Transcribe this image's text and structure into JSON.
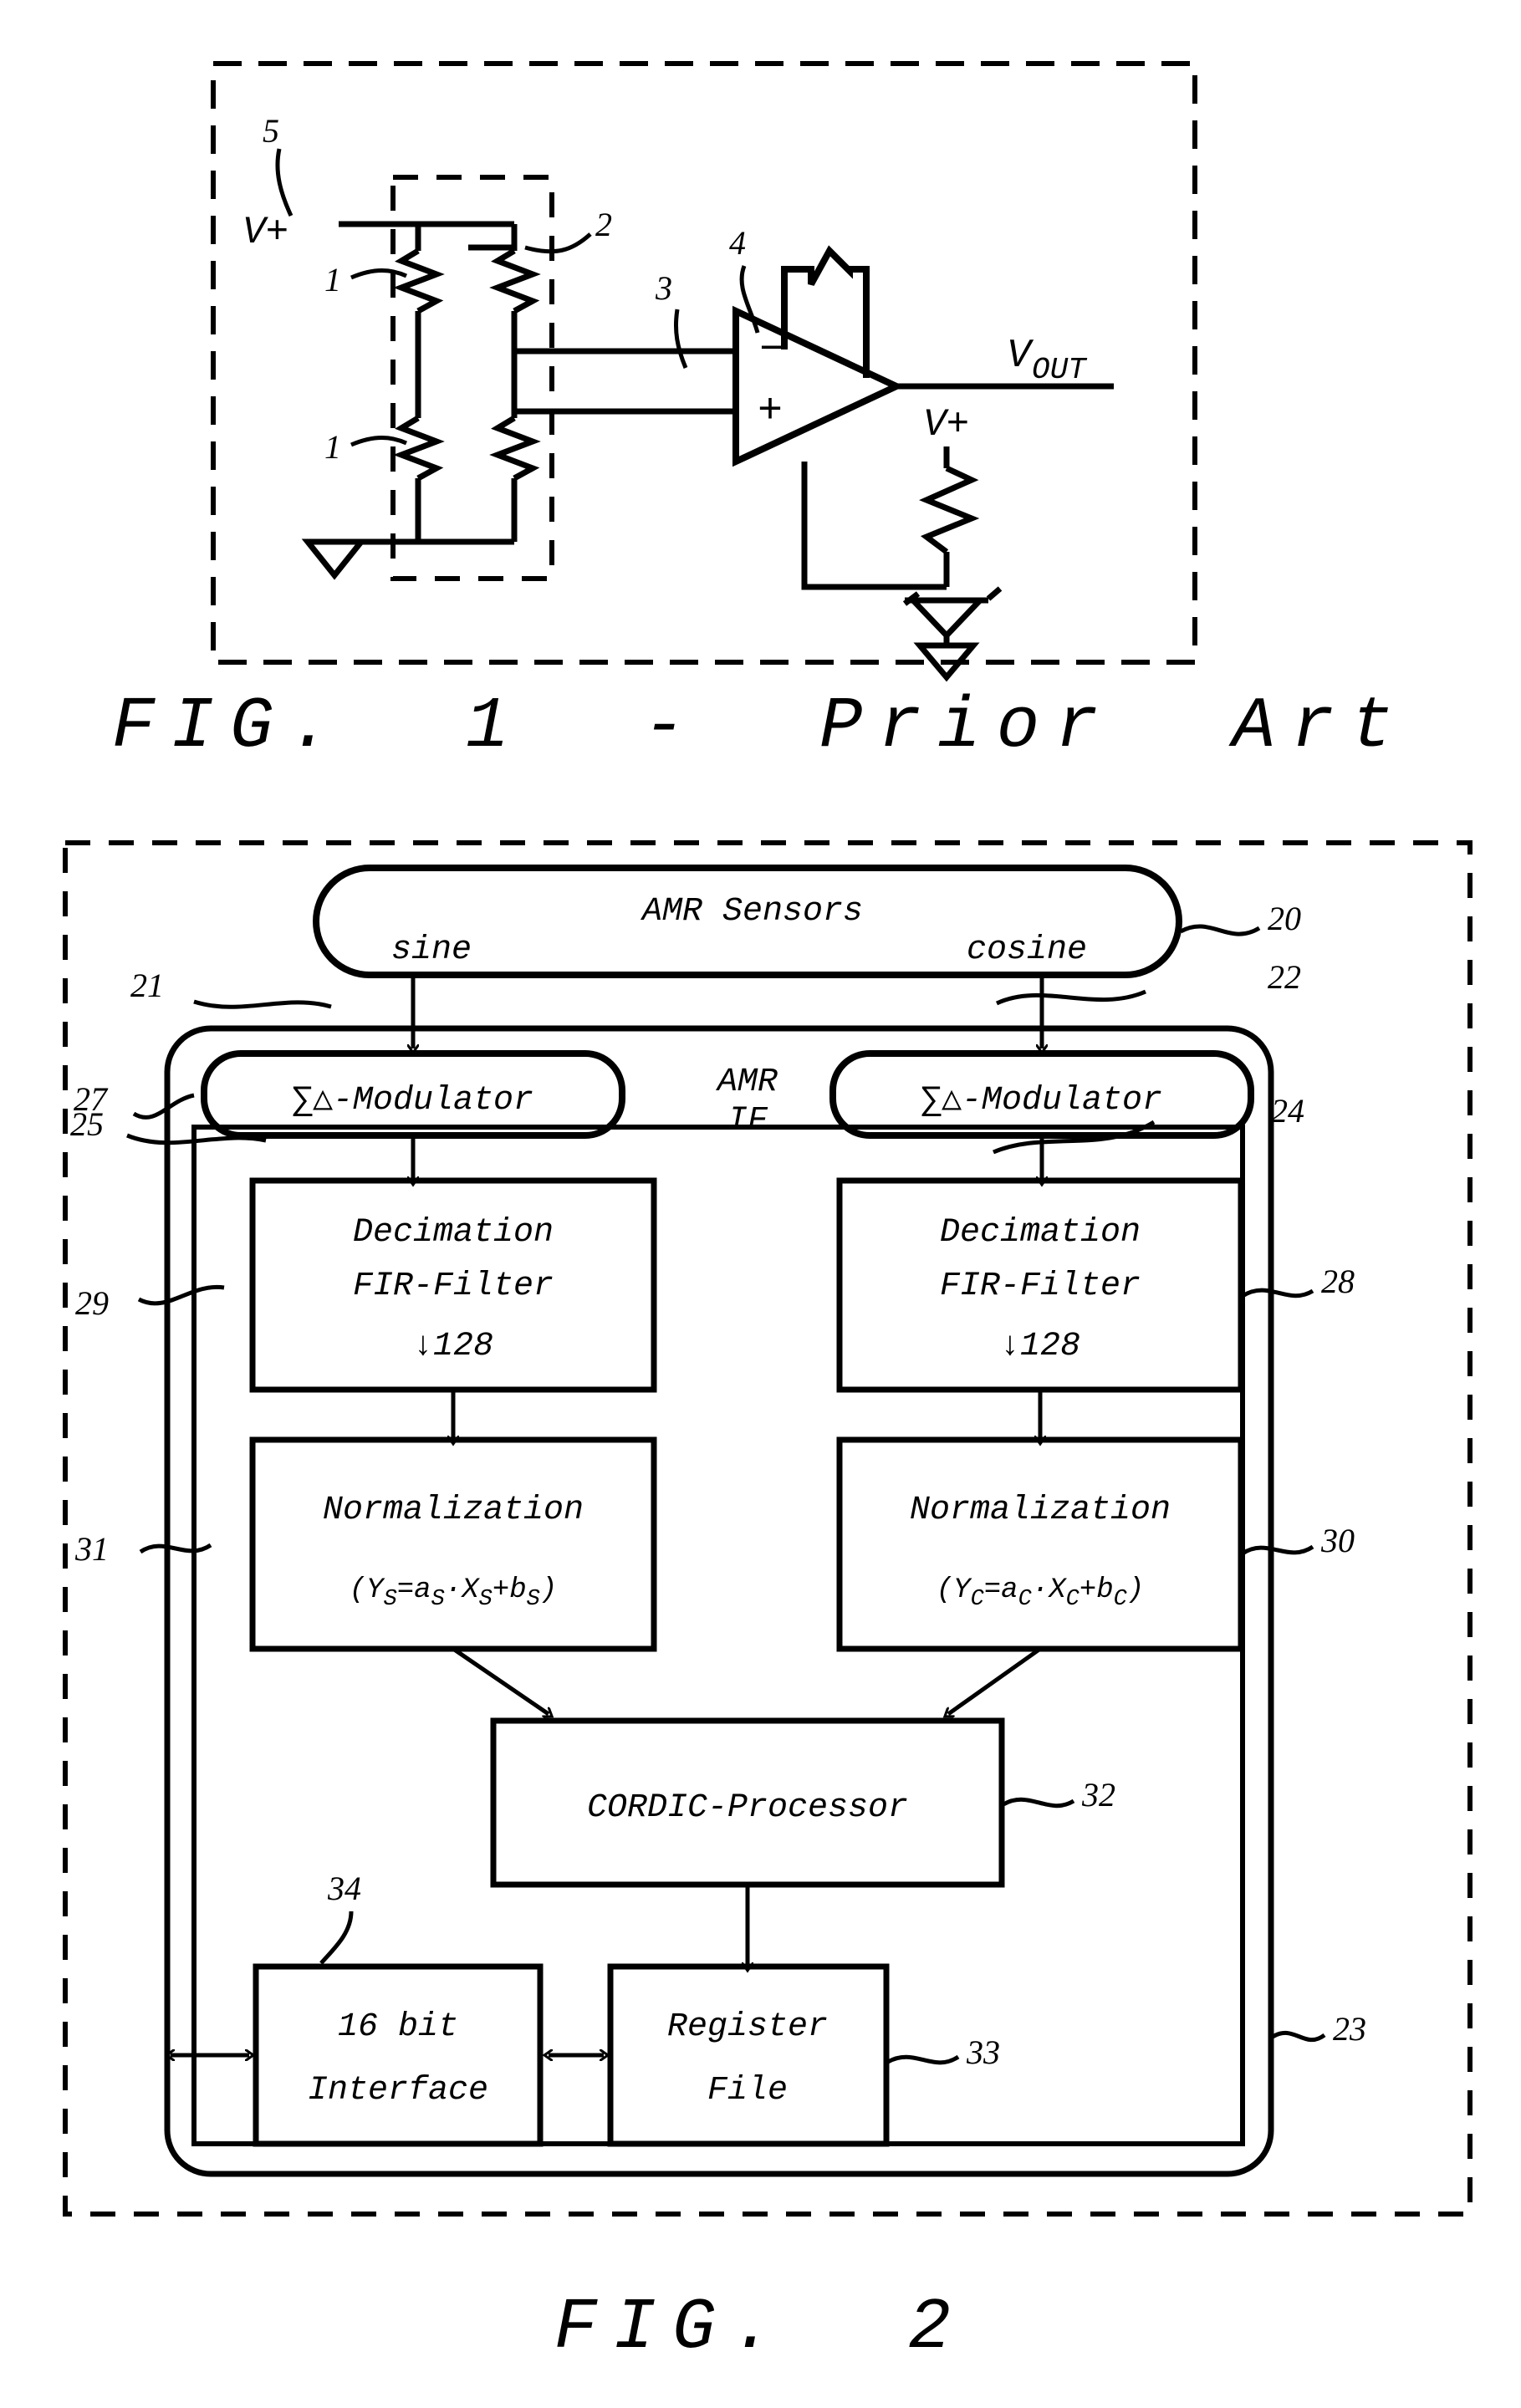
{
  "sheet": {
    "figures": [
      "FIG. 1 - Prior Art",
      "FIG. 2"
    ]
  },
  "fig1": {
    "caption": "FIG.  1  -  Prior  Art",
    "labels": {
      "supply_left": "V+",
      "supply_right": "V+",
      "output": "V",
      "output_sub": "OUT",
      "opamp_minus": "−",
      "opamp_plus": "+"
    },
    "refs": {
      "outer_box": "5",
      "bridge_resistor_left": "1",
      "bridge_resistor_left_lower": "1",
      "bridge_resistor_right": "2",
      "signal_lines": "3",
      "amplifier": "4"
    }
  },
  "fig2": {
    "caption": "FIG.  2",
    "blocks": {
      "sensors": {
        "title": "AMR Sensors",
        "left_signal": "sine",
        "right_signal": "cosine",
        "ref": "20"
      },
      "if_group": {
        "label_line1": "AMR",
        "label_line2": "IF",
        "ref": "23"
      },
      "modulator_left": {
        "label": "∑△-Modulator",
        "ref": "27"
      },
      "modulator_right": {
        "label": "∑△-Modulator",
        "ref": "24"
      },
      "fir_left": {
        "line1": "Decimation",
        "line2": "FIR-Filter",
        "line3": "↓128",
        "ref": "29"
      },
      "fir_right": {
        "line1": "Decimation",
        "line2": "FIR-Filter",
        "line3": "↓128",
        "ref": "28"
      },
      "norm_left": {
        "line1": "Normalization",
        "formula": "( Ys =as ·Xs+bs )",
        "ref": "31"
      },
      "norm_right": {
        "line1": "Normalization",
        "formula": "( Yc =ac ·Xc+bc )",
        "ref": "30"
      },
      "cordic": {
        "label": "CORDIC-Processor",
        "ref": "32"
      },
      "interface": {
        "line1": "16 bit",
        "line2": "Interface",
        "ref": "34"
      },
      "register": {
        "line1": "Register",
        "line2": "File",
        "ref": "33"
      }
    },
    "arrow_refs": {
      "sine_path": "21",
      "cosine_path": "22",
      "mod_out_left": "25",
      "mod_out_right": "24"
    },
    "formula_parts": {
      "norm_left": {
        "y": "Y",
        "y_sub": "S",
        "eq": "=a",
        "a_sub": "S",
        "dot": "·X",
        "x_sub": "S",
        "plus": "+b",
        "b_sub": "S"
      },
      "norm_right": {
        "y": "Y",
        "y_sub": "C",
        "eq": "=a",
        "a_sub": "C",
        "dot": "·X",
        "x_sub": "C",
        "plus": "+b",
        "b_sub": "C"
      }
    }
  },
  "colors": {
    "ink": "#000000",
    "paper": "#ffffff"
  }
}
